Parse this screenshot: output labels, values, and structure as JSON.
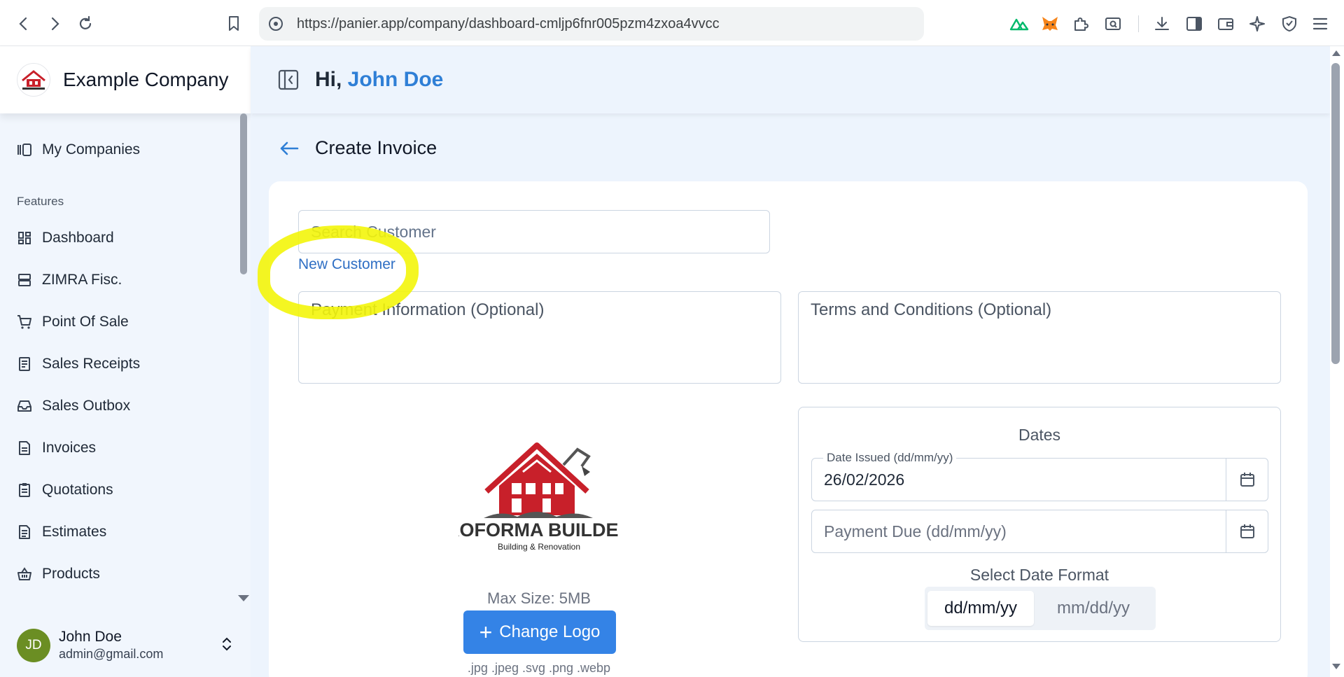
{
  "browser": {
    "url": "https://panier.app/company/dashboard-cmljp6fnr005pzm4zxoa4vvcc",
    "icons": [
      "back-icon",
      "forward-icon",
      "reload-icon",
      "bookmark-icon",
      "site-info-icon",
      "nuxt-extension-icon",
      "metamask-extension-icon",
      "extensions-icon",
      "screen-search-icon",
      "downloads-icon",
      "sidebar-icon",
      "wallet-icon",
      "ai-assistant-icon",
      "shield-icon",
      "menu-icon"
    ]
  },
  "sidebar": {
    "company_name": "Example Company",
    "my_companies": "My Companies",
    "section_label": "Features",
    "items": [
      {
        "label": "Dashboard",
        "icon": "dashboard-icon"
      },
      {
        "label": "ZIMRA Fisc.",
        "icon": "server-icon"
      },
      {
        "label": "Point Of Sale",
        "icon": "cart-icon"
      },
      {
        "label": "Sales Receipts",
        "icon": "receipt-icon"
      },
      {
        "label": "Sales Outbox",
        "icon": "inbox-icon"
      },
      {
        "label": "Invoices",
        "icon": "document-icon"
      },
      {
        "label": "Quotations",
        "icon": "clipboard-icon"
      },
      {
        "label": "Estimates",
        "icon": "document-list-icon"
      },
      {
        "label": "Products",
        "icon": "basket-icon"
      }
    ],
    "user": {
      "initials": "JD",
      "name": "John Doe",
      "email": "admin@gmail.com"
    }
  },
  "header": {
    "greeting_prefix": "Hi, ",
    "user_name": "John Doe"
  },
  "page": {
    "title": "Create Invoice",
    "search_customer_placeholder": "Search Customer",
    "new_customer_link": "New Customer",
    "payment_info_placeholder": "Payment Information (Optional)",
    "terms_placeholder": "Terms and Conditions (Optional)",
    "logo": {
      "brand_main": "PROFORMA BUILDERS",
      "brand_sub": "Building & Renovation",
      "max_size": "Max Size: 5MB",
      "change_logo_label": "Change Logo",
      "formats": ".jpg .jpeg .svg .png .webp"
    },
    "dates": {
      "title": "Dates",
      "date_issued_label": "Date Issued (dd/mm/yy)",
      "date_issued_value": "26/02/2026",
      "payment_due_placeholder": "Payment Due (dd/mm/yy)",
      "format_label": "Select Date Format",
      "format_options": [
        "dd/mm/yy",
        "mm/dd/yy"
      ],
      "selected_format": "dd/mm/yy"
    }
  },
  "colors": {
    "accent": "#2f7fd6",
    "primary_button": "#3483e6",
    "highlight": "#f3f50a",
    "sidebar_bg": "#f1f6fd",
    "main_bg": "#edf4fd",
    "logo_red": "#c8202a"
  }
}
